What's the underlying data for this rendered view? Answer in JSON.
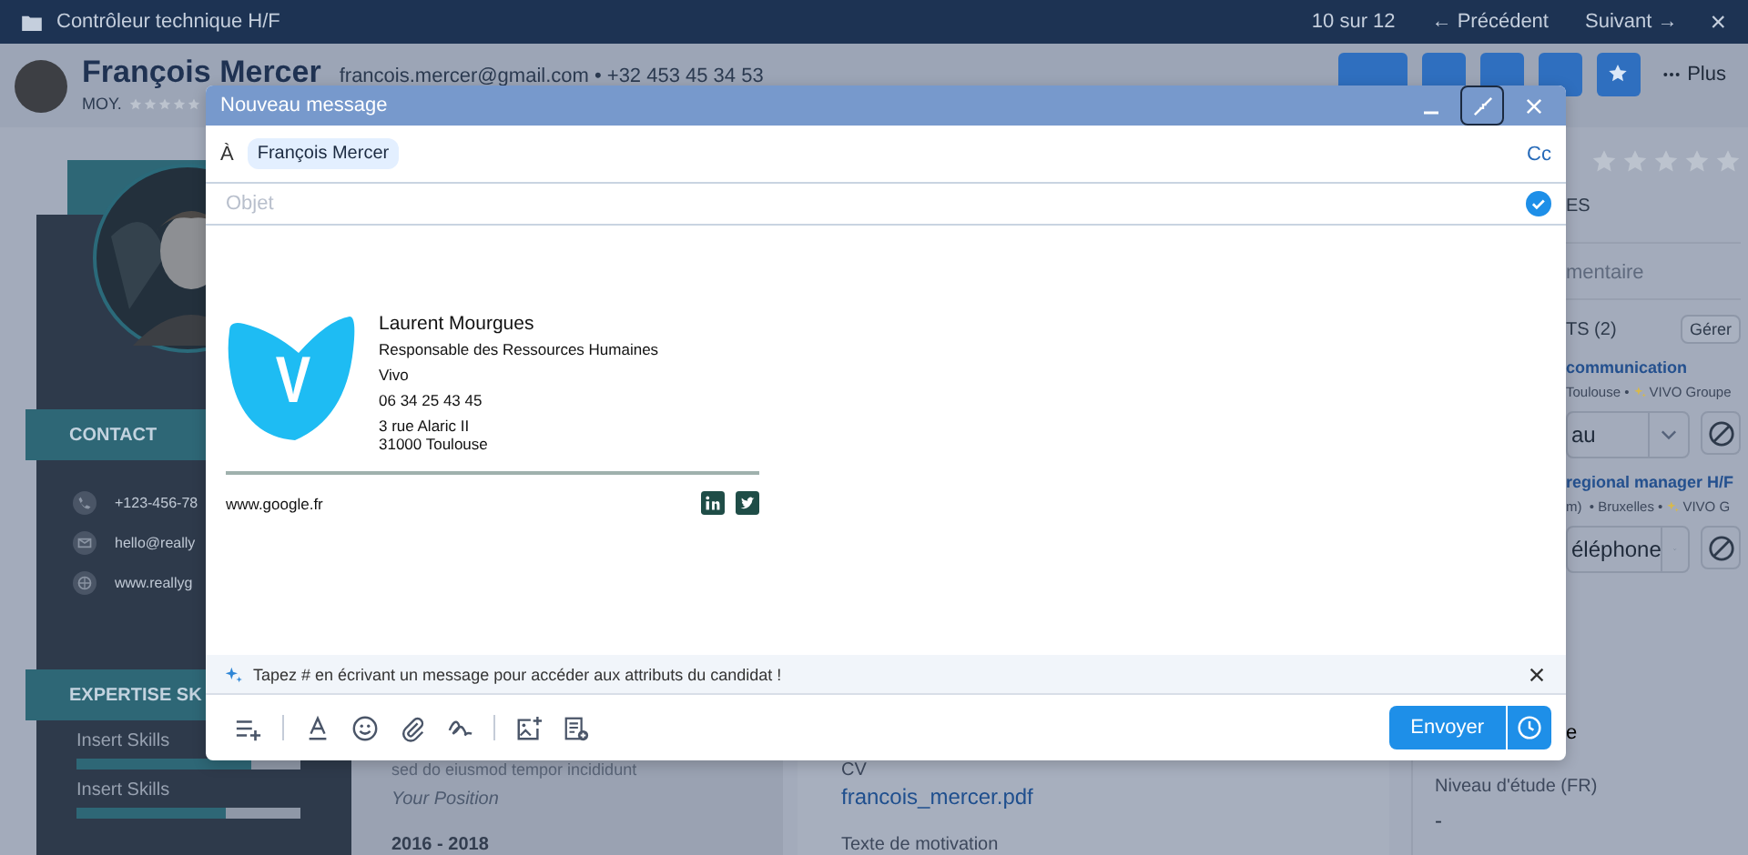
{
  "top_bar": {
    "title": "Contrôleur technique H/F",
    "position": "10 sur 12",
    "previous": "← Précédent",
    "next": "Suivant →",
    "close": "×"
  },
  "candidate": {
    "name": "François Mercer",
    "contact": "francois.mercer@gmail.com • +32 453 45 34 53",
    "rating_label": "MOY.",
    "stars": 0,
    "more": "Plus"
  },
  "cv": {
    "contact_heading": "CONTACT",
    "contacts": [
      {
        "kind": "phone",
        "text": "+123-456-78"
      },
      {
        "kind": "email",
        "text": "hello@really"
      },
      {
        "kind": "web",
        "text": "www.reallyg"
      }
    ],
    "skills_heading": "EXPERTISE SK",
    "skills": [
      {
        "label": "Insert Skills",
        "level": 0.78
      },
      {
        "label": "Insert Skills",
        "level": 0.67
      }
    ]
  },
  "middle": {
    "summary": "sed do eiusmod tempor incididunt",
    "position": "Your Position",
    "dates": "2016 - 2018",
    "cv_label": "CV",
    "cv_file": "francois_mercer.pdf",
    "motivation_label": "Texte de motivation"
  },
  "side": {
    "stars": 0,
    "notes_heading": "ES",
    "comment_placeholder": "mentaire",
    "jobs_heading": "TS (2)",
    "manage": "Gérer",
    "jobs": [
      {
        "title": "communication",
        "meta": "Toulouse •",
        "company": "VIVO Groupe",
        "stage": "au"
      },
      {
        "title": "regional manager H/F",
        "meta": "m)  • Bruxelles •",
        "company": "VIVO G",
        "stage": "éléphone"
      }
    ],
    "field_tail": "e",
    "education_label": "Niveau d'étude (FR)",
    "education_value": "-"
  },
  "composer": {
    "title": "Nouveau message",
    "to_label": "À",
    "recipient": "François Mercer",
    "cc": "Cc",
    "subject_placeholder": "Objet",
    "signature": {
      "logo_letter": "V",
      "name": "Laurent Mourgues",
      "role": "Responsable des Ressources Humaines",
      "company": "Vivo",
      "phone": "06 34 25 43 45",
      "address": [
        "3 rue Alaric II",
        "31000 Toulouse"
      ],
      "website": "www.google.fr"
    },
    "hint": "Tapez # en écrivant un message pour accéder aux attributs du candidat !",
    "send": "Envoyer"
  }
}
